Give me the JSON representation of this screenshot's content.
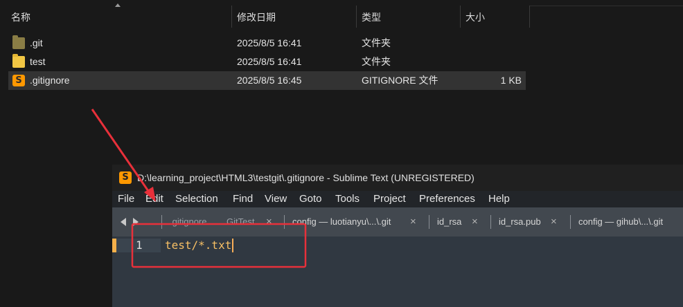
{
  "explorer": {
    "columns": {
      "name": "名称",
      "date": "修改日期",
      "type": "类型",
      "size": "大小"
    },
    "files": [
      {
        "name": ".git",
        "date": "2025/8/5 16:41",
        "type": "文件夹",
        "size": "",
        "icon": "folder-icon"
      },
      {
        "name": "test",
        "date": "2025/8/5 16:41",
        "type": "文件夹",
        "size": "",
        "icon": "folder-icon"
      },
      {
        "name": ".gitignore",
        "date": "2025/8/5 16:45",
        "type": "GITIGNORE 文件",
        "size": "1 KB",
        "icon": "sublime-file-icon"
      }
    ]
  },
  "sublime": {
    "title": "D:\\learning_project\\HTML3\\testgit\\.gitignore - Sublime Text (UNREGISTERED)",
    "menu": [
      "File",
      "Edit",
      "Selection",
      "Find",
      "View",
      "Goto",
      "Tools",
      "Project",
      "Preferences",
      "Help"
    ],
    "tabs": [
      {
        "label": ".gitignore",
        "active": true
      },
      {
        "label": "GitTest",
        "active": false
      },
      {
        "label": "config — luotianyu\\...\\.git",
        "active": false
      },
      {
        "label": "id_rsa",
        "active": false
      },
      {
        "label": "id_rsa.pub",
        "active": false
      },
      {
        "label": "config — gihub\\...\\.git",
        "active": false
      }
    ],
    "close_glyph": "×",
    "editor": {
      "line_number": "1",
      "code": "test/*.txt"
    }
  },
  "annotation": {
    "color": "#e8303a"
  }
}
